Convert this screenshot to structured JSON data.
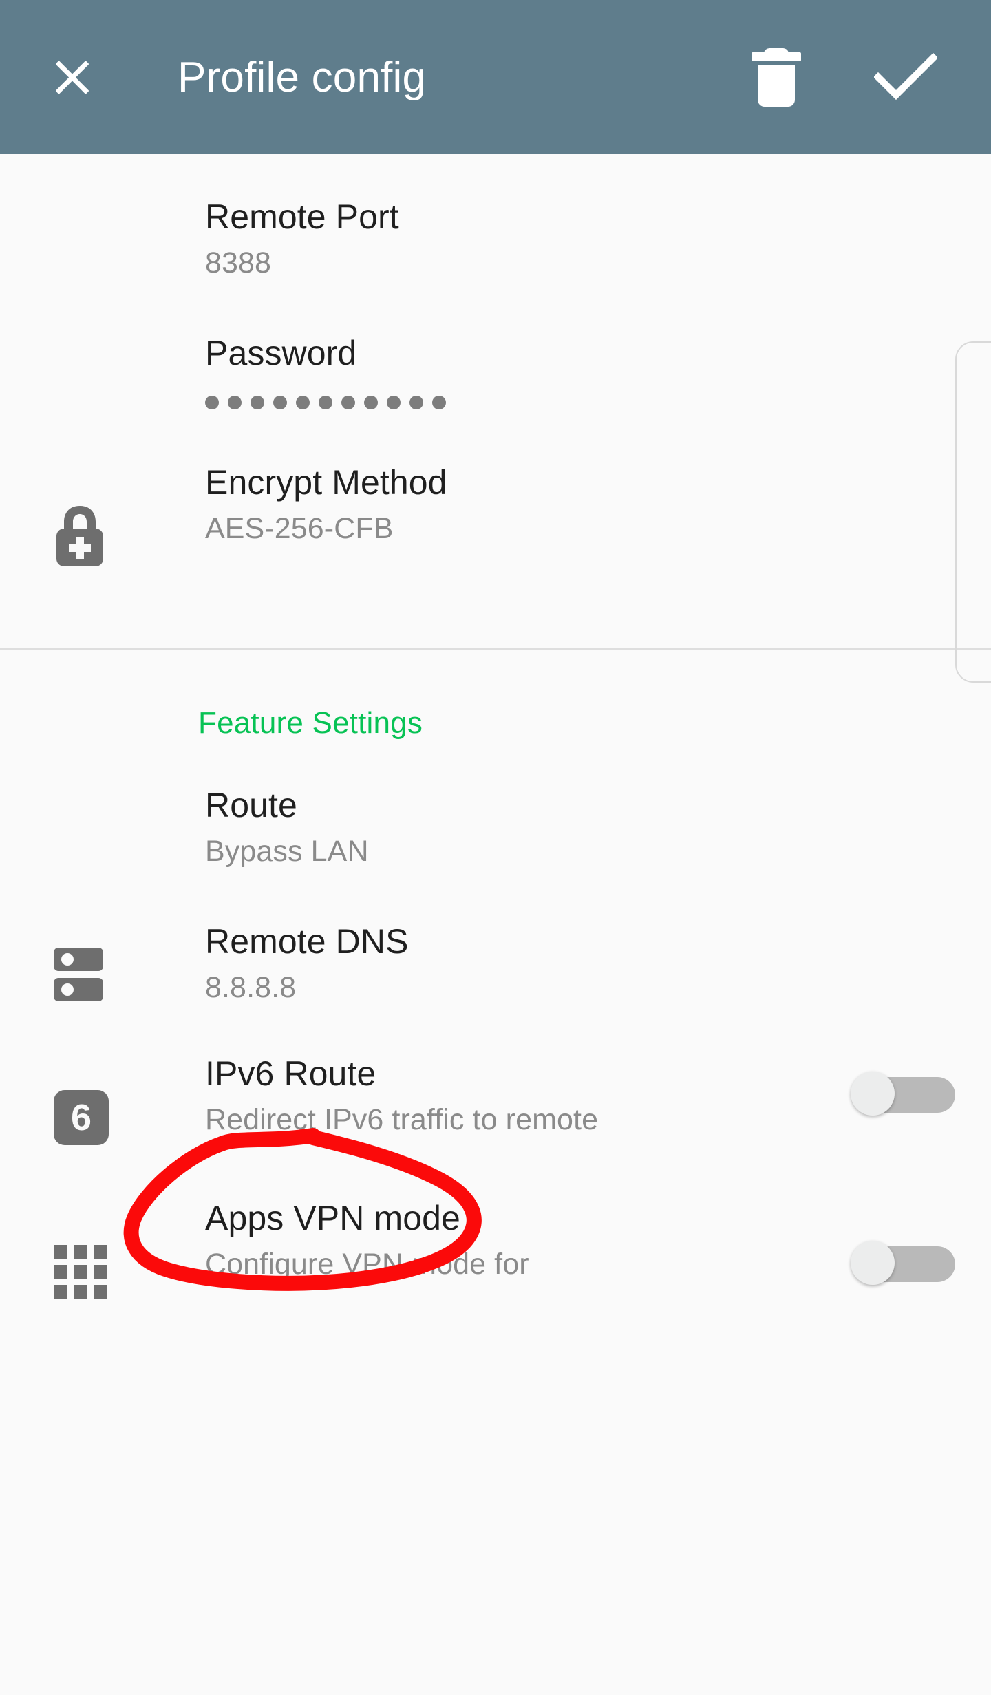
{
  "toolbar": {
    "title": "Profile config",
    "close_icon": "close-icon",
    "delete_icon": "trash-icon",
    "confirm_icon": "check-icon"
  },
  "colors": {
    "toolbar_bg": "#5f7d8c",
    "page_bg": "#fafafa",
    "accent_green": "#07c254",
    "title_text": "#1f1f1f",
    "sub_text": "#8a8a8a",
    "icon_gray": "#6e6e6e",
    "annotation_red": "#fb0a0a",
    "toggle_track_off": "#b9b9b9",
    "toggle_thumb_off": "#eceded",
    "divider": "#dedede"
  },
  "server_section": {
    "rows": [
      {
        "name": "remote-port",
        "title": "Remote Port",
        "subtitle": "8388",
        "icon": null,
        "toggle": null
      },
      {
        "name": "password",
        "title": "Password",
        "subtitle": "•••••••••••",
        "masked_char_count": 11,
        "icon": null,
        "toggle": null
      },
      {
        "name": "encrypt-method",
        "title": "Encrypt Method",
        "subtitle": "AES-256-CFB",
        "icon": "lock-plus-icon",
        "toggle": null
      }
    ]
  },
  "feature_section": {
    "header": "Feature Settings",
    "rows": [
      {
        "name": "route",
        "title": "Route",
        "subtitle": "Bypass LAN",
        "icon": null,
        "toggle": null
      },
      {
        "name": "remote-dns",
        "title": "Remote DNS",
        "subtitle": "8.8.8.8",
        "icon": "server-icon",
        "toggle": null,
        "annotated": true
      },
      {
        "name": "ipv6-route",
        "title": "IPv6 Route",
        "subtitle": "Redirect IPv6 traffic to remote",
        "icon": "ipv6-badge-icon",
        "icon_label": "6",
        "toggle": "off"
      },
      {
        "name": "apps-vpn-mode",
        "title": "Apps VPN mode",
        "subtitle": "Configure VPN mode for",
        "icon": "apps-grid-icon",
        "toggle": "off"
      }
    ]
  },
  "annotation": {
    "shape": "hand-drawn-ellipse",
    "target": "Remote DNS",
    "color": "#fb0a0a"
  },
  "scrollbar": {
    "orientation": "vertical",
    "position": "right"
  }
}
